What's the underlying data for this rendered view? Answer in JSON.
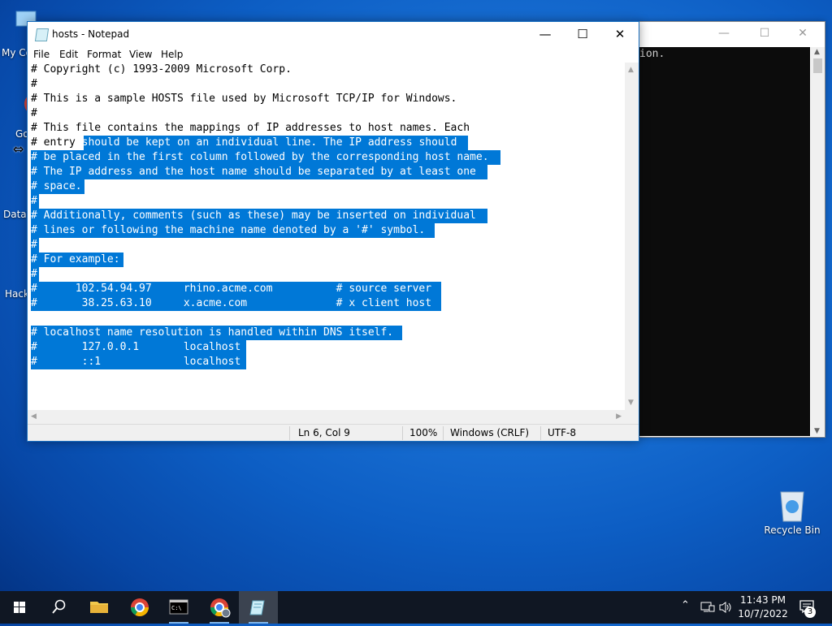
{
  "desktop": {
    "icons_left": [
      {
        "label": "My Co",
        "icon": "computer-icon"
      },
      {
        "label": "Go",
        "icon": "chrome-shortcut-icon"
      },
      {
        "label": "DataV",
        "icon": "datav-shortcut-icon"
      },
      {
        "label": "Hack",
        "icon": "terminal-shortcut-icon"
      }
    ],
    "recycle_bin": {
      "label": "Recycle Bin",
      "icon": "recycle-bin-icon"
    }
  },
  "console_window": {
    "visible_text": "ion.",
    "controls": {
      "minimize": "—",
      "maximize": "☐",
      "close": "✕"
    }
  },
  "notepad": {
    "title": "hosts - Notepad",
    "menu": [
      "File",
      "Edit",
      "Format",
      "View",
      "Help"
    ],
    "controls": {
      "minimize": "—",
      "maximize": "☐",
      "close": "✕"
    },
    "lines": [
      "# Copyright (c) 1993-2009 Microsoft Corp.",
      "#",
      "# This is a sample HOSTS file used by Microsoft TCP/IP for Windows.",
      "#",
      "# This file contains the mappings of IP addresses to host names. Each",
      "# entry should be kept on an individual line. The IP address should",
      "# be placed in the first column followed by the corresponding host name.",
      "# The IP address and the host name should be separated by at least one",
      "# space.",
      "#",
      "# Additionally, comments (such as these) may be inserted on individual",
      "# lines or following the machine name denoted by a '#' symbol.",
      "#",
      "# For example:",
      "#",
      "#      102.54.94.97     rhino.acme.com          # source server",
      "#       38.25.63.10     x.acme.com              # x client host",
      "",
      "# localhost name resolution is handled within DNS itself.",
      "#\t127.0.0.1       localhost",
      "#\t::1             localhost"
    ],
    "status": {
      "position": "Ln 6, Col 9",
      "zoom": "100%",
      "line_endings": "Windows (CRLF)",
      "encoding": "UTF-8"
    }
  },
  "taskbar": {
    "items": [
      {
        "name": "start-button",
        "icon": "windows-logo-icon"
      },
      {
        "name": "search-button",
        "icon": "search-icon"
      },
      {
        "name": "file-explorer",
        "icon": "folder-icon"
      },
      {
        "name": "chrome",
        "icon": "chrome-icon"
      },
      {
        "name": "command-prompt",
        "icon": "cmd-icon"
      },
      {
        "name": "chrome-profile",
        "icon": "chrome-profile-icon"
      },
      {
        "name": "notepad",
        "icon": "notepad-icon"
      }
    ],
    "tray": {
      "time": "11:43 PM",
      "date": "10/7/2022",
      "notification_count": "3"
    }
  },
  "colors": {
    "selection": "#0078d7",
    "taskbar": "#101723",
    "console_bg": "#0c0c0c"
  }
}
